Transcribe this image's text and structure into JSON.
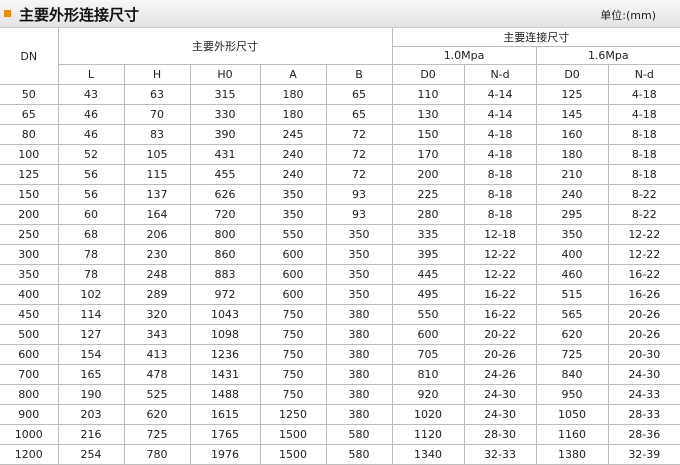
{
  "header": {
    "title": "主要外形连接尺寸",
    "unit": "单位:(mm)"
  },
  "table": {
    "dn_label": "DN",
    "dims_group": "主要外形尺寸",
    "conn_group": "主要连接尺寸",
    "pressure_1": "1.0Mpa",
    "pressure_2": "1.6Mpa",
    "columns": [
      "L",
      "H",
      "H0",
      "A",
      "B",
      "D0",
      "N-d",
      "D0",
      "N-d"
    ],
    "rows": [
      [
        "50",
        "43",
        "63",
        "315",
        "180",
        "65",
        "110",
        "4-14",
        "125",
        "4-18"
      ],
      [
        "65",
        "46",
        "70",
        "330",
        "180",
        "65",
        "130",
        "4-14",
        "145",
        "4-18"
      ],
      [
        "80",
        "46",
        "83",
        "390",
        "245",
        "72",
        "150",
        "4-18",
        "160",
        "8-18"
      ],
      [
        "100",
        "52",
        "105",
        "431",
        "240",
        "72",
        "170",
        "4-18",
        "180",
        "8-18"
      ],
      [
        "125",
        "56",
        "115",
        "455",
        "240",
        "72",
        "200",
        "8-18",
        "210",
        "8-18"
      ],
      [
        "150",
        "56",
        "137",
        "626",
        "350",
        "93",
        "225",
        "8-18",
        "240",
        "8-22"
      ],
      [
        "200",
        "60",
        "164",
        "720",
        "350",
        "93",
        "280",
        "8-18",
        "295",
        "8-22"
      ],
      [
        "250",
        "68",
        "206",
        "800",
        "550",
        "350",
        "335",
        "12-18",
        "350",
        "12-22"
      ],
      [
        "300",
        "78",
        "230",
        "860",
        "600",
        "350",
        "395",
        "12-22",
        "400",
        "12-22"
      ],
      [
        "350",
        "78",
        "248",
        "883",
        "600",
        "350",
        "445",
        "12-22",
        "460",
        "16-22"
      ],
      [
        "400",
        "102",
        "289",
        "972",
        "600",
        "350",
        "495",
        "16-22",
        "515",
        "16-26"
      ],
      [
        "450",
        "114",
        "320",
        "1043",
        "750",
        "380",
        "550",
        "16-22",
        "565",
        "20-26"
      ],
      [
        "500",
        "127",
        "343",
        "1098",
        "750",
        "380",
        "600",
        "20-22",
        "620",
        "20-26"
      ],
      [
        "600",
        "154",
        "413",
        "1236",
        "750",
        "380",
        "705",
        "20-26",
        "725",
        "20-30"
      ],
      [
        "700",
        "165",
        "478",
        "1431",
        "750",
        "380",
        "810",
        "24-26",
        "840",
        "24-30"
      ],
      [
        "800",
        "190",
        "525",
        "1488",
        "750",
        "380",
        "920",
        "24-30",
        "950",
        "24-33"
      ],
      [
        "900",
        "203",
        "620",
        "1615",
        "1250",
        "380",
        "1020",
        "24-30",
        "1050",
        "28-33"
      ],
      [
        "1000",
        "216",
        "725",
        "1765",
        "1500",
        "580",
        "1120",
        "28-30",
        "1160",
        "28-36"
      ],
      [
        "1200",
        "254",
        "780",
        "1976",
        "1500",
        "580",
        "1340",
        "32-33",
        "1380",
        "32-39"
      ]
    ]
  }
}
